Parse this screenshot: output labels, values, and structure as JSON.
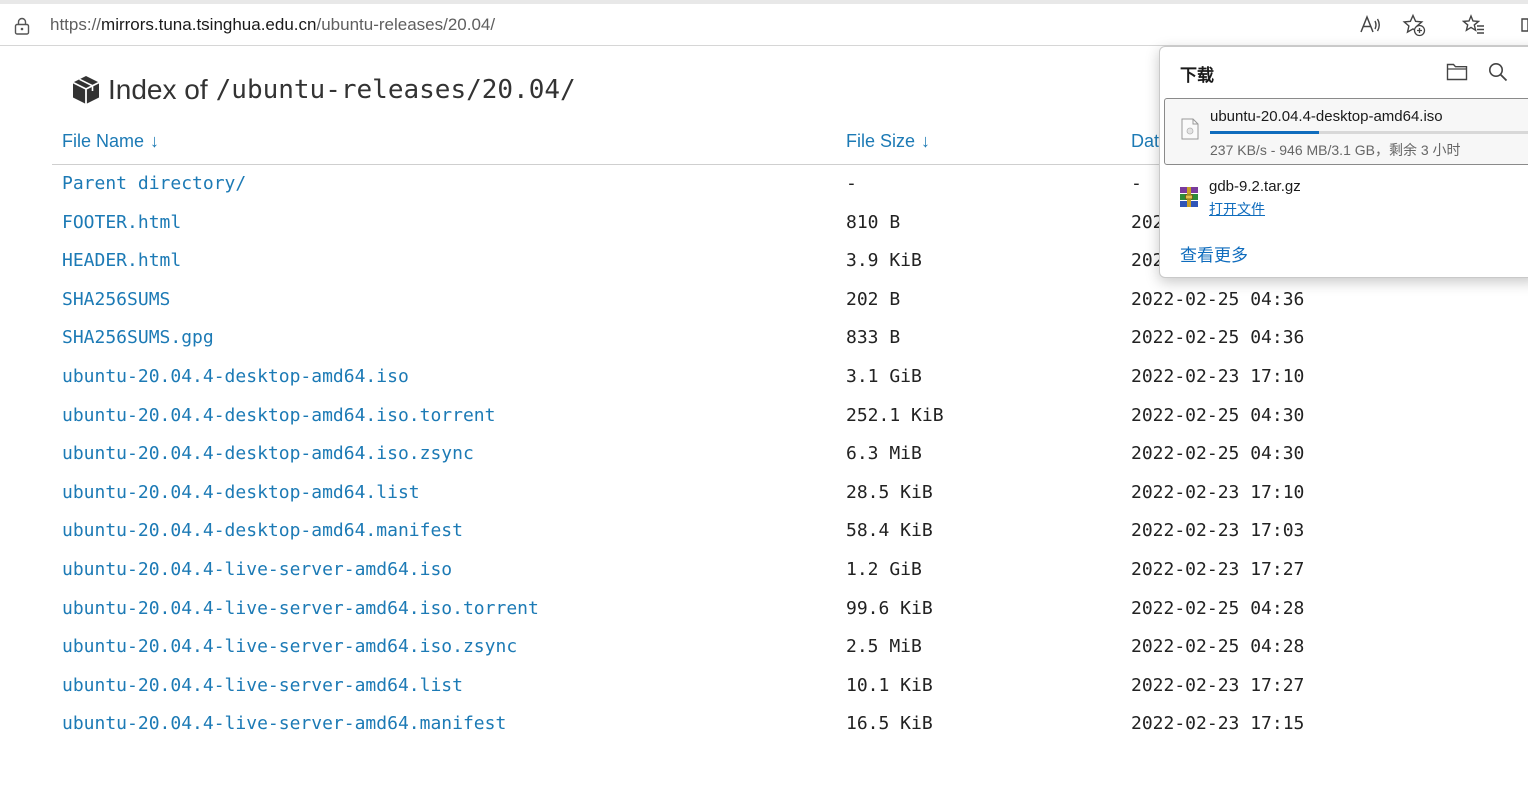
{
  "browser": {
    "url_scheme": "https://",
    "url_host": "mirrors.tuna.tsinghua.edu.cn",
    "url_path": "/ubuntu-releases/20.04/"
  },
  "page": {
    "title_prefix": "Index of",
    "title_path": "/ubuntu-releases/20.04/",
    "columns": {
      "name": "File Name",
      "size": "File Size",
      "date": "Dat",
      "sort_arrow": "↓"
    },
    "files": [
      {
        "name": "Parent directory/",
        "size": "-",
        "date": "-"
      },
      {
        "name": "FOOTER.html",
        "size": "810 B",
        "date": "202"
      },
      {
        "name": "HEADER.html",
        "size": "3.9 KiB",
        "date": "202"
      },
      {
        "name": "SHA256SUMS",
        "size": "202 B",
        "date": "2022-02-25 04:36"
      },
      {
        "name": "SHA256SUMS.gpg",
        "size": "833 B",
        "date": "2022-02-25 04:36"
      },
      {
        "name": "ubuntu-20.04.4-desktop-amd64.iso",
        "size": "3.1 GiB",
        "date": "2022-02-23 17:10"
      },
      {
        "name": "ubuntu-20.04.4-desktop-amd64.iso.torrent",
        "size": "252.1 KiB",
        "date": "2022-02-25 04:30"
      },
      {
        "name": "ubuntu-20.04.4-desktop-amd64.iso.zsync",
        "size": "6.3 MiB",
        "date": "2022-02-25 04:30"
      },
      {
        "name": "ubuntu-20.04.4-desktop-amd64.list",
        "size": "28.5 KiB",
        "date": "2022-02-23 17:10"
      },
      {
        "name": "ubuntu-20.04.4-desktop-amd64.manifest",
        "size": "58.4 KiB",
        "date": "2022-02-23 17:03"
      },
      {
        "name": "ubuntu-20.04.4-live-server-amd64.iso",
        "size": "1.2 GiB",
        "date": "2022-02-23 17:27"
      },
      {
        "name": "ubuntu-20.04.4-live-server-amd64.iso.torrent",
        "size": "99.6 KiB",
        "date": "2022-02-25 04:28"
      },
      {
        "name": "ubuntu-20.04.4-live-server-amd64.iso.zsync",
        "size": "2.5 MiB",
        "date": "2022-02-25 04:28"
      },
      {
        "name": "ubuntu-20.04.4-live-server-amd64.list",
        "size": "10.1 KiB",
        "date": "2022-02-23 17:27"
      },
      {
        "name": "ubuntu-20.04.4-live-server-amd64.manifest",
        "size": "16.5 KiB",
        "date": "2022-02-23 17:15"
      }
    ]
  },
  "downloads": {
    "title": "下载",
    "items": [
      {
        "name": "ubuntu-20.04.4-desktop-amd64.iso",
        "status": "237 KB/s - 946 MB/3.1 GB，剩余 3 小时",
        "progress_fraction": 0.33
      },
      {
        "name": "gdb-9.2.tar.gz",
        "action": "打开文件"
      }
    ],
    "more_label": "查看更多"
  },
  "colors": {
    "link": "#1c7ab5",
    "accent": "#0f6cbd"
  }
}
